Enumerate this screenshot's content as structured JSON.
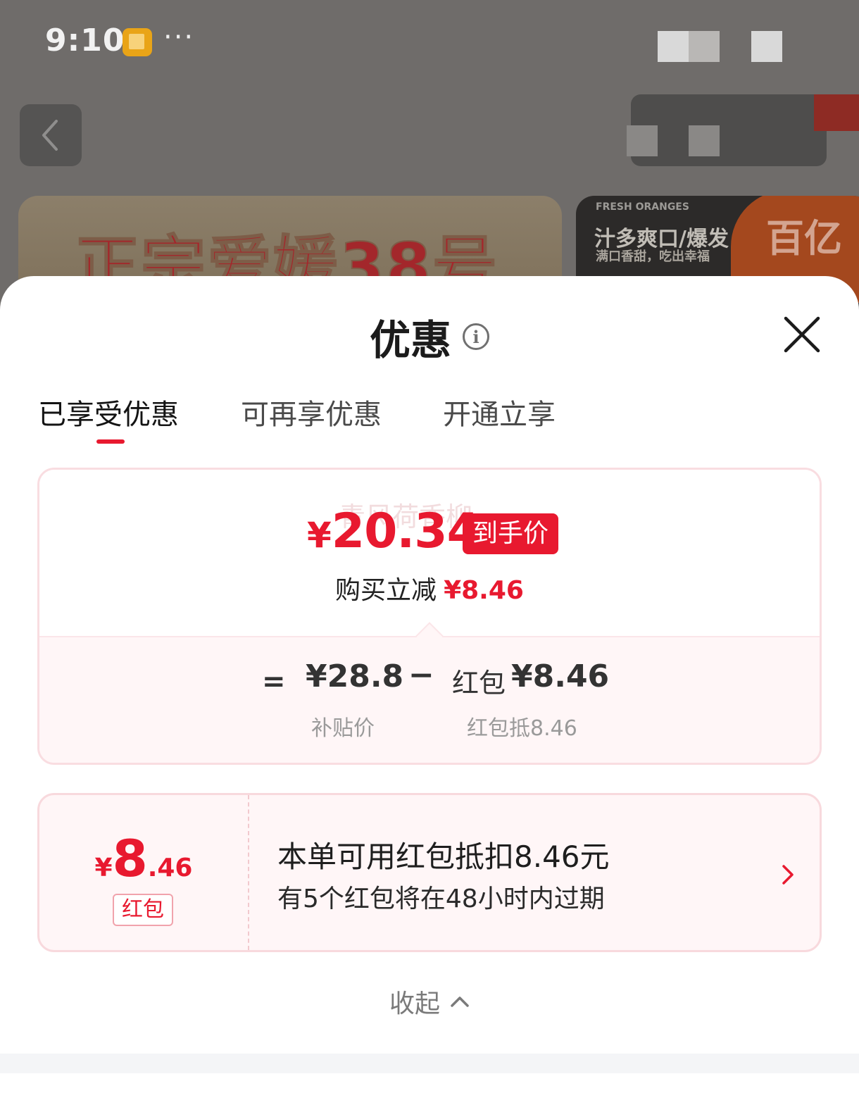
{
  "status_bar": {
    "time": "9:10",
    "more": "···"
  },
  "banners": {
    "left_title": "正宗爱媛38号",
    "right_sub": "FRESH ORANGES",
    "right_title": "汁多爽口/爆发",
    "right_line2": "满口香甜，吃出幸福",
    "right_badge": "百亿"
  },
  "sheet": {
    "title": "优惠",
    "tabs": [
      "已享受优惠",
      "可再享优惠",
      "开通立享"
    ],
    "active_tab_index": 0
  },
  "price_card": {
    "watermark": "青风荷香柳",
    "final_yen": "¥",
    "final_price": "20.34",
    "final_badge": "到手价",
    "reduce_label": "购买立减",
    "reduce_amount": "¥8.46",
    "formula": {
      "eq": "=",
      "base_value": "¥28.8",
      "minus": "−",
      "hongbao_label": "红包",
      "hongbao_value": "¥8.46",
      "base_caption": "补贴价",
      "hongbao_caption": "红包抵8.46"
    }
  },
  "hongbao_card": {
    "yen": "¥",
    "amount_int": "8",
    "amount_dec": ".46",
    "tag": "红包",
    "title": "本单可用红包抵扣8.46元",
    "subtitle": "有5个红包将在48小时内过期"
  },
  "collapse_label": "收起",
  "colors": {
    "accent": "#e8192f",
    "card_border": "#f9dde1",
    "card_bg": "#fff6f7"
  }
}
